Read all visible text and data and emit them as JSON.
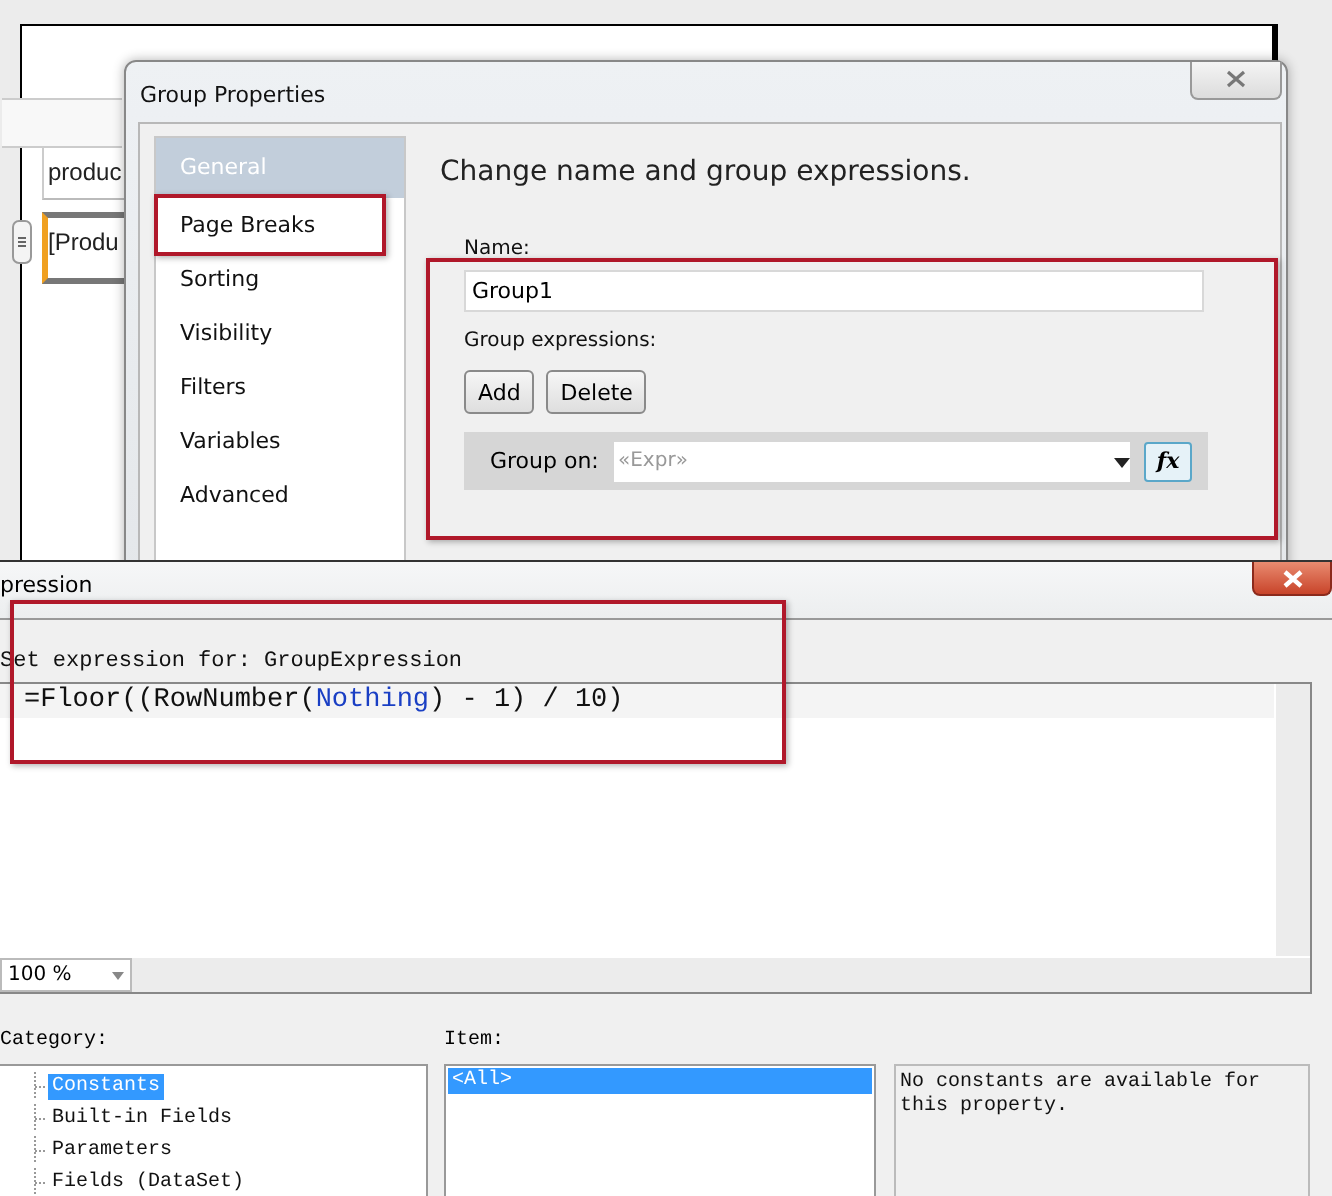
{
  "designer": {
    "header_cell": "produc",
    "field_cell": "[Produ"
  },
  "group_dialog": {
    "title": "Group Properties",
    "pages": [
      {
        "label": "General",
        "selected": true
      },
      {
        "label": "Page Breaks",
        "selected": false
      },
      {
        "label": "Sorting",
        "selected": false
      },
      {
        "label": "Visibility",
        "selected": false
      },
      {
        "label": "Filters",
        "selected": false
      },
      {
        "label": "Variables",
        "selected": false
      },
      {
        "label": "Advanced",
        "selected": false
      }
    ],
    "heading": "Change name and group expressions.",
    "name_label": "Name:",
    "name_value": "Group1",
    "expressions_label": "Group expressions:",
    "buttons": [
      "Add",
      "Delete"
    ],
    "group_on_label": "Group on:",
    "group_on_placeholder": "«Expr»",
    "function_button": "fx"
  },
  "expression_dialog": {
    "title": "pression",
    "prompt": "Set expression for: GroupExpression",
    "code": [
      {
        "text": "=Floor((RowNumber(",
        "kind": "plain"
      },
      {
        "text": "Nothing",
        "kind": "keyword"
      },
      {
        "text": ") - 1) / 10)",
        "kind": "plain"
      }
    ],
    "zoom": "100 %",
    "category_label": "Category:",
    "categories": [
      {
        "label": "Constants",
        "selected": true
      },
      {
        "label": "Built-in Fields",
        "selected": false
      },
      {
        "label": "Parameters",
        "selected": false
      },
      {
        "label": "Fields (DataSet)",
        "selected": false
      }
    ],
    "item_label": "Item:",
    "items": [
      {
        "label": "<All>",
        "selected": true
      }
    ],
    "description": "No constants are available for this property."
  }
}
